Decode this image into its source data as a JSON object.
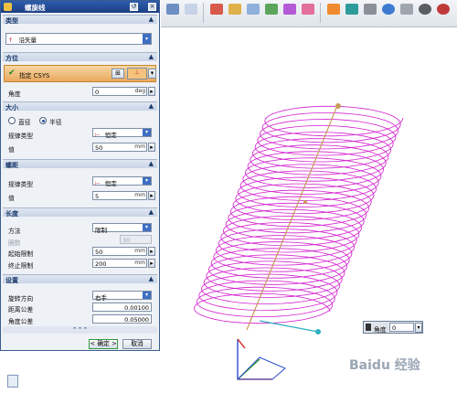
{
  "dialog": {
    "title": "螺旋线",
    "sections": {
      "type": {
        "title": "类型",
        "value": "沿矢量"
      },
      "orientation": {
        "title": "方位",
        "csys_label": "指定 CSYS",
        "angle_label": "角度",
        "angle_value": "0",
        "angle_unit": "deg"
      },
      "size": {
        "title": "大小",
        "diameter_label": "直径",
        "radius_label": "半径",
        "law_type_label": "规律类型",
        "law_type_value": "恒定",
        "value_label": "值",
        "value": "50",
        "unit": "mm"
      },
      "pitch": {
        "title": "螺距",
        "law_type_label": "规律类型",
        "law_type_value": "恒定",
        "value_label": "值",
        "value": "5",
        "unit": "mm"
      },
      "length": {
        "title": "长度",
        "method_label": "方法",
        "method_value": "限制",
        "turns_label": "圈数",
        "turns_value": "30",
        "start_label": "起始限制",
        "start_value": "50",
        "end_label": "终止限制",
        "end_value": "200",
        "unit": "mm"
      },
      "settings": {
        "title": "设置",
        "rotation_label": "旋转方向",
        "rotation_value": "右手",
        "dist_tol_label": "距离公差",
        "dist_tol_value": "0.00100",
        "angle_tol_label": "角度公差",
        "angle_tol_value": "0.05000"
      }
    },
    "ok_label": "< 确定 >",
    "cancel_label": "取消"
  },
  "viewport": {
    "angle_popup_label": "角度",
    "angle_popup_value": "0"
  },
  "watermark": "Baidu 经验",
  "colors": {
    "helix": "#d21fcf",
    "axis": "#c89a5a",
    "titlebar": "#1c3f82",
    "csys_highlight": "#e8a85e"
  }
}
